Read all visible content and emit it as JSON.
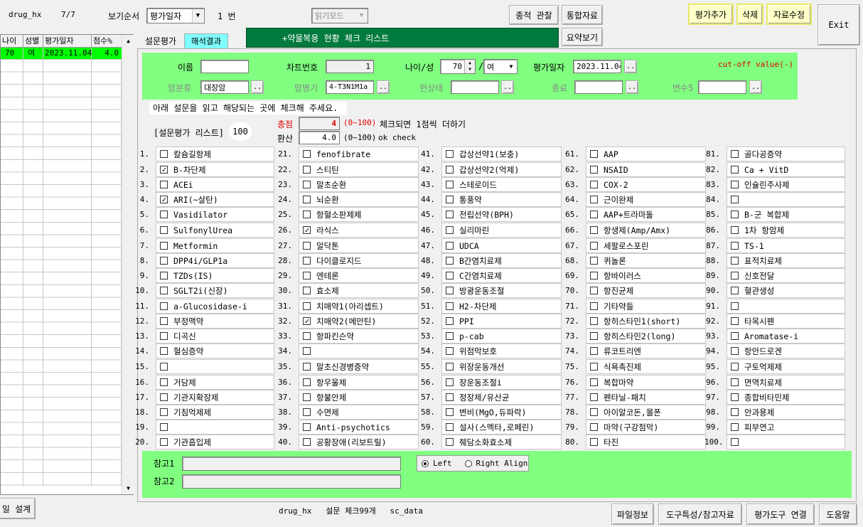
{
  "top": {
    "db_name": "drug_hx",
    "record_pos": "7/7",
    "sort_label": "보기순서",
    "sort_value": "평가일자",
    "count_label": "1 번",
    "readmode": "읽기모드",
    "btn_track": "종적 관찰",
    "btn_integrated": "통합자료",
    "btn_summary": "요약보기",
    "btn_add": "평가추가",
    "btn_delete": "삭제",
    "btn_edit": "자료수정",
    "btn_exit": "Exit"
  },
  "grid": {
    "headers": [
      "나이",
      "성별",
      "평가일자",
      "점수%"
    ],
    "rows": [
      [
        "70",
        "여",
        "2023.11.04",
        "4.0"
      ]
    ]
  },
  "tabs": {
    "survey": "설문평가",
    "result": "해석결과"
  },
  "banner": "+약물복용 현황 체크 리스트",
  "patient": {
    "name_label": "이름",
    "name_value": "",
    "chart_label": "차트번호",
    "chart_value": "1",
    "age_sex_label": "나이/성",
    "age_value": "70",
    "sex_value": "여",
    "date_label": "평가일자",
    "date_value": "2023.11.04",
    "cutoff": "cut-off value(-)",
    "cancer_label": "암분류",
    "cancer_value": "대장암",
    "stage_label": "암병기",
    "stage_value": "4-T3N1M1a",
    "current_label": "현상태",
    "current_value": "",
    "end_label": "종료",
    "end_value": "",
    "var5_label": "변수5",
    "var5_value": "",
    "dots": ".."
  },
  "instruction": "아래 설문을 읽고 해당되는 곳에 체크해 주세요.",
  "list_label": "[설문평가 리스트]",
  "list_count": "100",
  "score": {
    "total_label": "총점",
    "total_value": "4",
    "total_range": "(0~100)",
    "total_note": "체크되면 1점씩 더하기",
    "conv_label": "환산",
    "conv_value": "4.0",
    "conv_range": "(0~100)",
    "conv_note": "ok check"
  },
  "items": [
    {
      "n": "1.",
      "t": "칼슘길항제",
      "c": false
    },
    {
      "n": "2.",
      "t": "B-차단제",
      "c": true
    },
    {
      "n": "3.",
      "t": "ACEi",
      "c": false
    },
    {
      "n": "4.",
      "t": "ARI(~살탄)",
      "c": true
    },
    {
      "n": "5.",
      "t": "Vasidilator",
      "c": false
    },
    {
      "n": "6.",
      "t": "SulfonylUrea",
      "c": false
    },
    {
      "n": "7.",
      "t": "Metformin",
      "c": false
    },
    {
      "n": "8.",
      "t": "DPP4i/GLP1a",
      "c": false
    },
    {
      "n": "9.",
      "t": "TZDs(IS)",
      "c": false
    },
    {
      "n": "10.",
      "t": "SGLT2i(신장)",
      "c": false
    },
    {
      "n": "11.",
      "t": "a-Glucosidase-i",
      "c": false
    },
    {
      "n": "12.",
      "t": "부정맥약",
      "c": false
    },
    {
      "n": "13.",
      "t": "디곡신",
      "c": false
    },
    {
      "n": "14.",
      "t": "혈심증약",
      "c": false
    },
    {
      "n": "15.",
      "t": "",
      "c": false
    },
    {
      "n": "16.",
      "t": "거담제",
      "c": false
    },
    {
      "n": "17.",
      "t": "기관지확장제",
      "c": false
    },
    {
      "n": "18.",
      "t": "기침억제제",
      "c": false
    },
    {
      "n": "19.",
      "t": "",
      "c": false
    },
    {
      "n": "20.",
      "t": "기관흡입제",
      "c": false
    },
    {
      "n": "21.",
      "t": "fenofibrate",
      "c": false
    },
    {
      "n": "22.",
      "t": "스티틴",
      "c": false
    },
    {
      "n": "23.",
      "t": "말초순환",
      "c": false
    },
    {
      "n": "24.",
      "t": "뇌순환",
      "c": false
    },
    {
      "n": "25.",
      "t": "항혈소판제제",
      "c": false
    },
    {
      "n": "26.",
      "t": "라식스",
      "c": true
    },
    {
      "n": "27.",
      "t": "알닥톤",
      "c": false
    },
    {
      "n": "28.",
      "t": "다이클로지드",
      "c": false
    },
    {
      "n": "29.",
      "t": "엔테론",
      "c": false
    },
    {
      "n": "30.",
      "t": "효소제",
      "c": false
    },
    {
      "n": "31.",
      "t": "치매약1(아리셉트)",
      "c": false
    },
    {
      "n": "32.",
      "t": "치매약2(메만틴)",
      "c": true
    },
    {
      "n": "33.",
      "t": "항파킨슨약",
      "c": false
    },
    {
      "n": "34.",
      "t": "",
      "c": false
    },
    {
      "n": "35.",
      "t": "말초신경병증약",
      "c": false
    },
    {
      "n": "36.",
      "t": "항우울제",
      "c": false
    },
    {
      "n": "37.",
      "t": "항불안제",
      "c": false
    },
    {
      "n": "38.",
      "t": "수면제",
      "c": false
    },
    {
      "n": "39.",
      "t": "Anti-psychotics",
      "c": false
    },
    {
      "n": "40.",
      "t": "공황장애(리보트릴)",
      "c": false
    },
    {
      "n": "41.",
      "t": "갑상선약1(보충)",
      "c": false
    },
    {
      "n": "42.",
      "t": "갑상선약2(억제)",
      "c": false
    },
    {
      "n": "43.",
      "t": "스테로이드",
      "c": false
    },
    {
      "n": "44.",
      "t": "통풍약",
      "c": false
    },
    {
      "n": "45.",
      "t": "전립선약(BPH)",
      "c": false
    },
    {
      "n": "46.",
      "t": "실리마린",
      "c": false
    },
    {
      "n": "47.",
      "t": "UDCA",
      "c": false
    },
    {
      "n": "48.",
      "t": "B간염치료제",
      "c": false
    },
    {
      "n": "49.",
      "t": "C간염치료제",
      "c": false
    },
    {
      "n": "50.",
      "t": "방광운동조절",
      "c": false
    },
    {
      "n": "51.",
      "t": "H2-차단제",
      "c": false
    },
    {
      "n": "52.",
      "t": "PPI",
      "c": false
    },
    {
      "n": "53.",
      "t": "p-cab",
      "c": false
    },
    {
      "n": "54.",
      "t": "위점막보호",
      "c": false
    },
    {
      "n": "55.",
      "t": "위장운동개선",
      "c": false
    },
    {
      "n": "56.",
      "t": "장운동조절i",
      "c": false
    },
    {
      "n": "57.",
      "t": "정장제/유산균",
      "c": false
    },
    {
      "n": "58.",
      "t": "변비(MgO,듀파락)",
      "c": false
    },
    {
      "n": "59.",
      "t": "설사(스멕타,로페린)",
      "c": false
    },
    {
      "n": "60.",
      "t": "췌담소화효소제",
      "c": false
    },
    {
      "n": "61.",
      "t": "AAP",
      "c": false
    },
    {
      "n": "62.",
      "t": "NSAID",
      "c": false
    },
    {
      "n": "63.",
      "t": "COX-2",
      "c": false
    },
    {
      "n": "64.",
      "t": "근이완제",
      "c": false
    },
    {
      "n": "65.",
      "t": "AAP+트라마돌",
      "c": false
    },
    {
      "n": "66.",
      "t": "항생제(Amp/Amx)",
      "c": false
    },
    {
      "n": "67.",
      "t": "세팔로스포린",
      "c": false
    },
    {
      "n": "68.",
      "t": "퀴놀론",
      "c": false
    },
    {
      "n": "69.",
      "t": "항바이러스",
      "c": false
    },
    {
      "n": "70.",
      "t": "항진균제",
      "c": false
    },
    {
      "n": "71.",
      "t": "기타약들",
      "c": false
    },
    {
      "n": "72.",
      "t": "항히스타민1(short)",
      "c": false
    },
    {
      "n": "73.",
      "t": "항히스타민2(long)",
      "c": false
    },
    {
      "n": "74.",
      "t": "류코트리엔",
      "c": false
    },
    {
      "n": "75.",
      "t": "식욕촉진제",
      "c": false
    },
    {
      "n": "76.",
      "t": "복합마약",
      "c": false
    },
    {
      "n": "77.",
      "t": "펜타닐-패치",
      "c": false
    },
    {
      "n": "78.",
      "t": "아이알코돈,몰폰",
      "c": false
    },
    {
      "n": "79.",
      "t": "마약(구강점막)",
      "c": false
    },
    {
      "n": "80.",
      "t": "타진",
      "c": false
    },
    {
      "n": "81.",
      "t": "골다공증약",
      "c": false
    },
    {
      "n": "82.",
      "t": "Ca + VitD",
      "c": false
    },
    {
      "n": "83.",
      "t": "인슐린주사제",
      "c": false
    },
    {
      "n": "84.",
      "t": "",
      "c": false
    },
    {
      "n": "85.",
      "t": "B-군 복합제",
      "c": false
    },
    {
      "n": "86.",
      "t": "1차 항암제",
      "c": false
    },
    {
      "n": "87.",
      "t": "TS-1",
      "c": false
    },
    {
      "n": "88.",
      "t": "표적치료제",
      "c": false
    },
    {
      "n": "89.",
      "t": "신호전달",
      "c": false
    },
    {
      "n": "90.",
      "t": "혈관생성",
      "c": false
    },
    {
      "n": "91.",
      "t": "",
      "c": false
    },
    {
      "n": "92.",
      "t": "타목시펜",
      "c": false
    },
    {
      "n": "93.",
      "t": "Aromatase-i",
      "c": false
    },
    {
      "n": "94.",
      "t": "항안드로겐",
      "c": false
    },
    {
      "n": "95.",
      "t": "구토억제제",
      "c": false
    },
    {
      "n": "96.",
      "t": "면역치료제",
      "c": false
    },
    {
      "n": "97.",
      "t": "종합비타민제",
      "c": false
    },
    {
      "n": "98.",
      "t": "안과용제",
      "c": false
    },
    {
      "n": "99.",
      "t": "피부연고",
      "c": false
    },
    {
      "n": "100.",
      "t": "",
      "c": false
    }
  ],
  "notes": {
    "ref1": "참고1",
    "ref2": "참고2",
    "left": "Left",
    "right": "Right Align"
  },
  "footer": {
    "design": "일 설계",
    "status": "drug_hx   설문 체크99개   sc_data",
    "file_info": "파일정보",
    "tool_ref": "도구특성/참고자료",
    "tool_link": "평가도구 연결",
    "help": "도움말"
  }
}
